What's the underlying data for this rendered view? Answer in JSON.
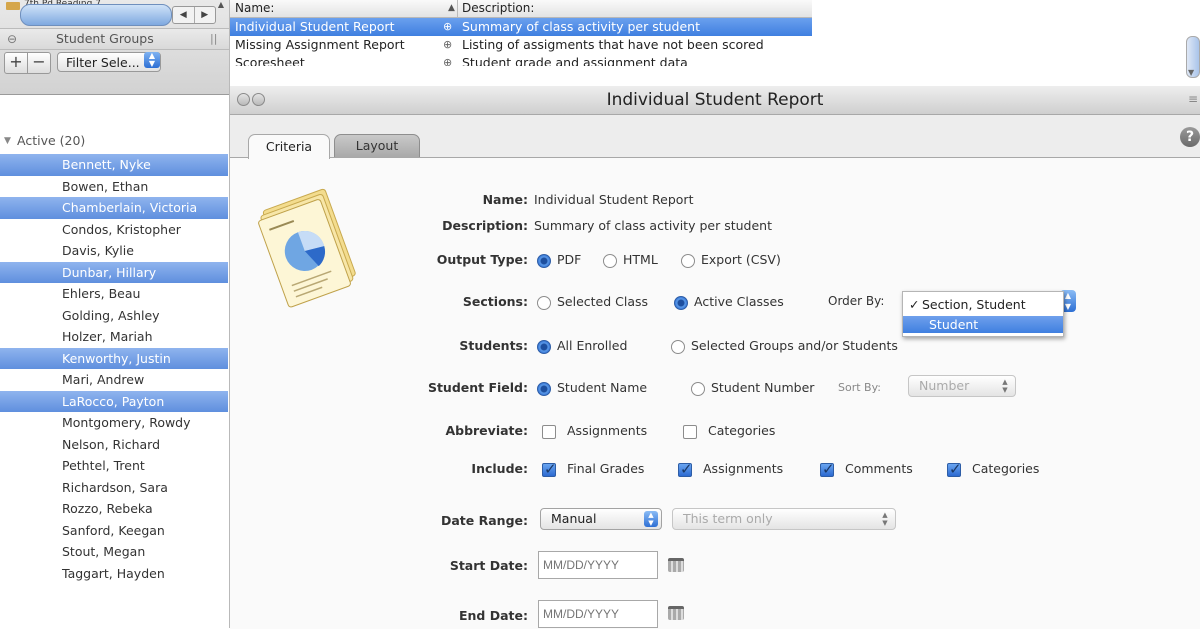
{
  "sidebar": {
    "top_truncated_text": "7th Pd Reading 7",
    "nav_left": "◀",
    "nav_right": "▶",
    "groups_label": "Student Groups",
    "plus_label": "+",
    "minus_label": "−",
    "filter_label": "Filter Sele...",
    "active_label": "Active (20)",
    "students": [
      {
        "name": "Bennett, Nyke",
        "selected": true
      },
      {
        "name": "Bowen, Ethan",
        "selected": false
      },
      {
        "name": "Chamberlain, Victoria",
        "selected": true
      },
      {
        "name": "Condos, Kristopher",
        "selected": false
      },
      {
        "name": "Davis, Kylie",
        "selected": false
      },
      {
        "name": "Dunbar, Hillary",
        "selected": true
      },
      {
        "name": "Ehlers, Beau",
        "selected": false
      },
      {
        "name": "Golding, Ashley",
        "selected": false
      },
      {
        "name": "Holzer, Mariah",
        "selected": false
      },
      {
        "name": "Kenworthy, Justin",
        "selected": true
      },
      {
        "name": "Mari, Andrew",
        "selected": false
      },
      {
        "name": "LaRocco, Payton",
        "selected": true
      },
      {
        "name": "Montgomery, Rowdy",
        "selected": false
      },
      {
        "name": "Nelson, Richard",
        "selected": false
      },
      {
        "name": "Pethtel, Trent",
        "selected": false
      },
      {
        "name": "Richardson, Sara",
        "selected": false
      },
      {
        "name": "Rozzo, Rebeka",
        "selected": false
      },
      {
        "name": "Sanford, Keegan",
        "selected": false
      },
      {
        "name": "Stout, Megan",
        "selected": false
      },
      {
        "name": "Taggart, Hayden",
        "selected": false
      }
    ]
  },
  "report_list": {
    "header_name": "Name:",
    "header_desc": "Description:",
    "sort_indicator": "▲",
    "rows": [
      {
        "name": "Individual Student Report",
        "description": "Summary of class activity per student",
        "selected": true
      },
      {
        "name": "Missing Assignment Report",
        "description": "Listing of assigments that have not been scored",
        "selected": false
      },
      {
        "name": "Scoresheet",
        "description": "Student grade and assignment data",
        "selected": false
      }
    ]
  },
  "window": {
    "title": "Individual Student Report",
    "help_label": "?",
    "tabs": [
      {
        "label": "Criteria",
        "active": true
      },
      {
        "label": "Layout",
        "active": false
      }
    ]
  },
  "form": {
    "name_label": "Name:",
    "name_value": "Individual Student Report",
    "description_label": "Description:",
    "description_value": "Summary of class activity per student",
    "output_type_label": "Output Type:",
    "output_pdf": "PDF",
    "output_html": "HTML",
    "output_csv": "Export (CSV)",
    "sections_label": "Sections:",
    "sections_selected": "Selected Class",
    "sections_active": "Active Classes",
    "order_by_label": "Order By:",
    "order_by_options": [
      "Section, Student",
      "Student"
    ],
    "order_by_check": "✓",
    "students_label": "Students:",
    "students_all": "All Enrolled",
    "students_selected": "Selected Groups and/or Students",
    "student_field_label": "Student Field:",
    "student_field_name": "Student Name",
    "student_field_number": "Student Number",
    "sort_by_label": "Sort By:",
    "sort_by_value": "Number",
    "abbreviate_label": "Abbreviate:",
    "abbr_assignments": "Assignments",
    "abbr_categories": "Categories",
    "include_label": "Include:",
    "inc_final_grades": "Final Grades",
    "inc_assignments": "Assignments",
    "inc_comments": "Comments",
    "inc_categories": "Categories",
    "date_range_label": "Date Range:",
    "date_range_value": "Manual",
    "term_value": "This term only",
    "start_date_label": "Start Date:",
    "end_date_label": "End Date:",
    "date_placeholder": "MM/DD/YYYY"
  },
  "colors": {
    "selection": "#5f8fde",
    "radio_on": "#2c6ad0"
  }
}
